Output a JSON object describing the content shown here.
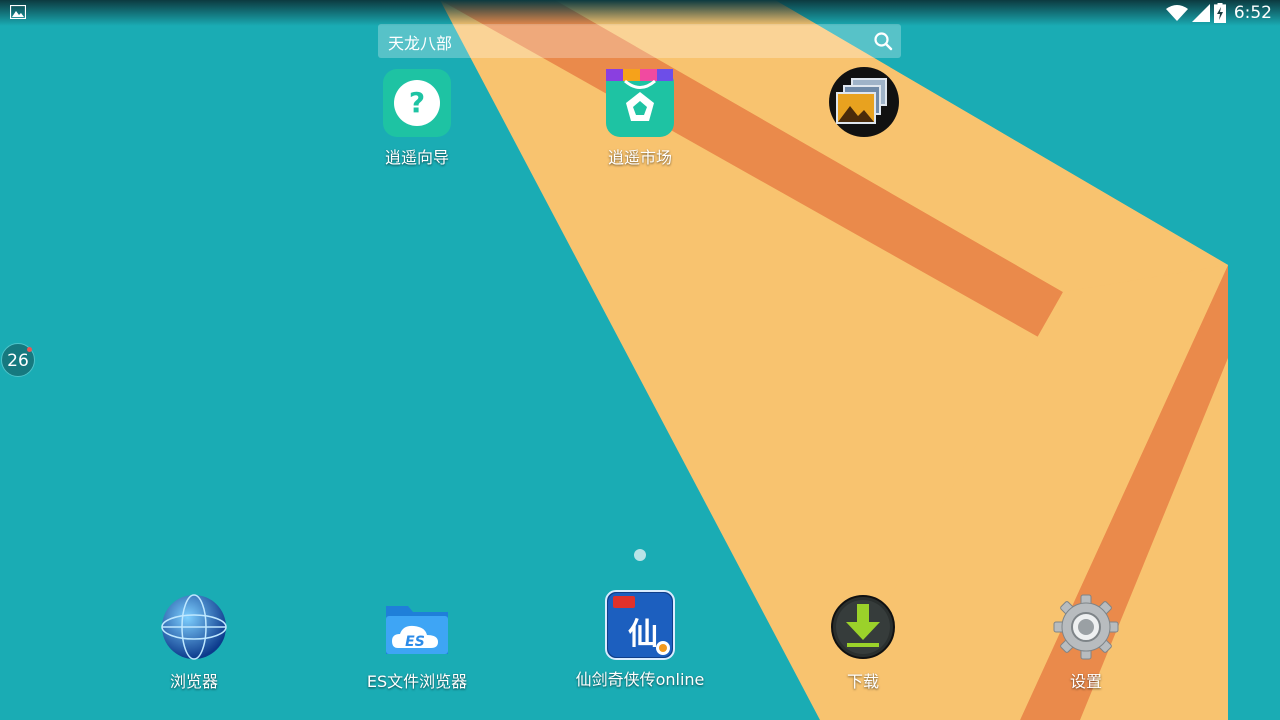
{
  "status_bar": {
    "time": "6:52",
    "icons": [
      "image-notification-icon",
      "wifi-icon",
      "signal-icon",
      "battery-charging-icon"
    ]
  },
  "search": {
    "text": "天龙八部",
    "icon": "search-icon"
  },
  "float_ball": {
    "count": "26"
  },
  "desktop_apps": [
    {
      "label": "逍遥向导",
      "icon": "help-guide-icon"
    },
    {
      "label": "逍遥市场",
      "icon": "market-bag-icon"
    },
    {
      "label": "",
      "icon": "gallery-icon"
    }
  ],
  "dock_apps": [
    {
      "label": "浏览器",
      "icon": "globe-browser-icon"
    },
    {
      "label": "ES文件浏览器",
      "icon": "es-folder-icon"
    },
    {
      "label": "仙剑奇侠传online",
      "icon": "xianjian-game-icon"
    },
    {
      "label": "下载",
      "icon": "download-icon"
    },
    {
      "label": "设置",
      "icon": "settings-gear-icon"
    }
  ],
  "colors": {
    "background": "#1aacb4",
    "stripe_light": "#f8c36f",
    "stripe_dark": "#ea8a4b"
  }
}
